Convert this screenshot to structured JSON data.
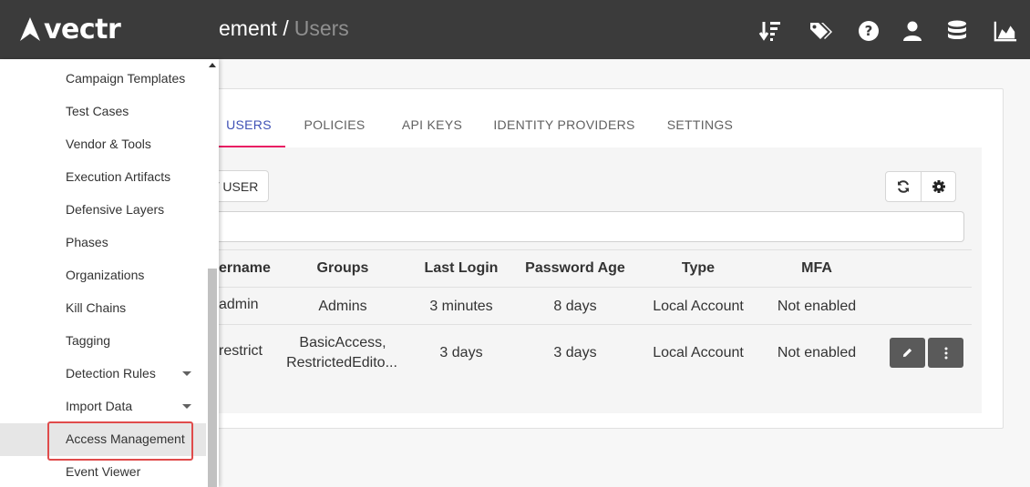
{
  "app": {
    "name": "vectr"
  },
  "header": {
    "breadcrumb_parent": "ement /",
    "breadcrumb_current": "Users",
    "icons": [
      "sort-icon",
      "tags-icon",
      "help-icon",
      "user-icon",
      "database-icon",
      "chart-icon"
    ]
  },
  "tabs": [
    "USERS",
    "POLICIES",
    "API KEYS",
    "IDENTITY PROVIDERS",
    "SETTINGS"
  ],
  "toolbar": {
    "new_user_label": "/ USER"
  },
  "search": {
    "placeholder": "",
    "value": ""
  },
  "table": {
    "columns": [
      "sername",
      "Groups",
      "Last Login",
      "Password Age",
      "Type",
      "MFA"
    ],
    "rows": [
      {
        "username": "admin",
        "groups": [
          "Admins"
        ],
        "last_login": "3 minutes",
        "password_age": "8 days",
        "type": "Local Account",
        "mfa": "Not enabled"
      },
      {
        "username": "restrict",
        "groups": [
          "BasicAccess,",
          "RestrictedEdito..."
        ],
        "last_login": "3 days",
        "password_age": "3 days",
        "type": "Local Account",
        "mfa": "Not enabled"
      }
    ]
  },
  "sidebar": {
    "items": [
      {
        "label": "Campaign Templates"
      },
      {
        "label": "Test Cases"
      },
      {
        "label": "Vendor & Tools"
      },
      {
        "label": "Execution Artifacts"
      },
      {
        "label": "Defensive Layers"
      },
      {
        "label": "Phases"
      },
      {
        "label": "Organizations"
      },
      {
        "label": "Kill Chains"
      },
      {
        "label": "Tagging"
      },
      {
        "label": "Detection Rules"
      },
      {
        "label": "Import Data"
      },
      {
        "label": "Access Management"
      },
      {
        "label": "Event Viewer"
      }
    ],
    "active_item": "Access Management",
    "expandable_items": [
      "Detection Rules",
      "Import Data"
    ]
  },
  "colors": {
    "header_bg": "#3b3b3b",
    "tab_active_text": "#3f51b5",
    "tab_active_underline": "#e91e63",
    "highlight_box": "#e04b4b",
    "row_button_bg": "#5a5a5a"
  }
}
